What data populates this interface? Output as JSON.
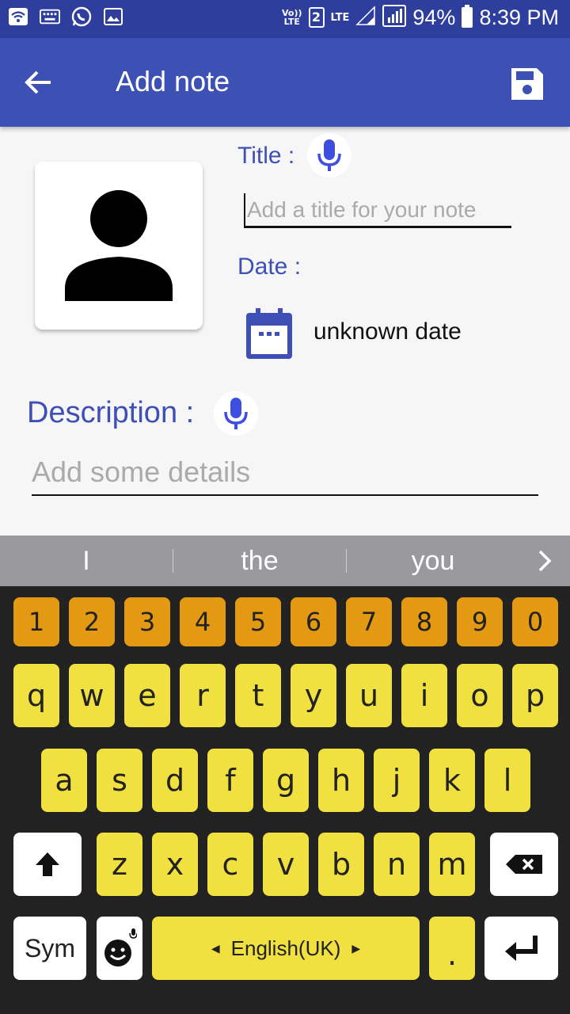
{
  "status_bar": {
    "volte": "Vo))\nLTE",
    "sim": "2",
    "network": "LTE",
    "battery": "94%",
    "time": "8:39 PM",
    "icons": [
      "wifi-icon",
      "keyboard-icon",
      "whatsapp-icon",
      "image-icon",
      "signal-icon",
      "battery-icon"
    ]
  },
  "app_bar": {
    "title": "Add note",
    "back_icon": "arrow-back-icon",
    "save_icon": "save-icon"
  },
  "form": {
    "title_label": "Title :",
    "title_placeholder": "Add a title for your note",
    "title_value": "",
    "date_label": "Date :",
    "date_value": "unknown date",
    "description_label": "Description :",
    "description_placeholder": "Add some details",
    "description_value": ""
  },
  "suggestions": [
    "I",
    "the",
    "you"
  ],
  "keyboard": {
    "numbers": [
      "1",
      "2",
      "3",
      "4",
      "5",
      "6",
      "7",
      "8",
      "9",
      "0"
    ],
    "row1": [
      "q",
      "w",
      "e",
      "r",
      "t",
      "y",
      "u",
      "i",
      "o",
      "p"
    ],
    "row2": [
      "a",
      "s",
      "d",
      "f",
      "g",
      "h",
      "j",
      "k",
      "l"
    ],
    "row3": [
      "z",
      "x",
      "c",
      "v",
      "b",
      "n",
      "m"
    ],
    "sym": "Sym",
    "space": "English(UK)",
    "period": "."
  },
  "colors": {
    "status_bar": "#2d3e9c",
    "app_bar": "#3d51b5",
    "accent": "#3e4fb5",
    "number_key": "#e39a12",
    "letter_key": "#f0e040",
    "keyboard_bg": "#222222",
    "suggestion_bar": "#9a9a9e"
  }
}
